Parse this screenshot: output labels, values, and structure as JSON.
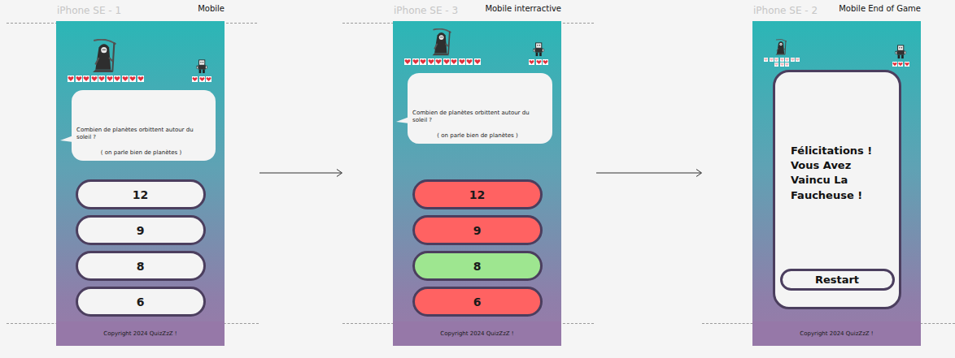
{
  "canvas": {
    "frames": [
      {
        "name": "iPhone SE - 1",
        "label": "Mobile",
        "kind": "question",
        "revealed": false,
        "boss": {
          "hearts": 10,
          "max": 10
        },
        "player": {
          "hearts": 3,
          "max": 3
        },
        "question": "Combien de planètes orbittent autour du soleil ?",
        "hint": "( on parle bien de planètes )",
        "answers": [
          {
            "label": "12",
            "correct": false
          },
          {
            "label": "9",
            "correct": false
          },
          {
            "label": "8",
            "correct": true
          },
          {
            "label": "6",
            "correct": false
          }
        ],
        "footer": "Copyright 2024 QuizZzZ !"
      },
      {
        "name": "iPhone SE - 3",
        "label": "Mobile interractive",
        "kind": "answered",
        "revealed": true,
        "boss": {
          "hearts": 10,
          "max": 10
        },
        "player": {
          "hearts": 3,
          "max": 3
        },
        "question": "Combien de planètes orbittent autour du soleil ?",
        "hint": "( on parle bien de planètes )",
        "answers": [
          {
            "label": "12",
            "correct": false
          },
          {
            "label": "9",
            "correct": false
          },
          {
            "label": "8",
            "correct": true
          },
          {
            "label": "6",
            "correct": false
          }
        ],
        "footer": "Copyright 2024 QuizZzZ !"
      },
      {
        "name": "iPhone SE - 2",
        "label": "Mobile End of Game",
        "kind": "end",
        "revealed": false,
        "boss": {
          "hearts": 0,
          "max": 10
        },
        "player": {
          "hearts": 3,
          "max": 3
        },
        "message": "Félicitations ! Vous Avez Vaincu La Faucheuse !",
        "button": "Restart",
        "footer": "Copyright 2024 QuizZzZ !"
      }
    ]
  }
}
